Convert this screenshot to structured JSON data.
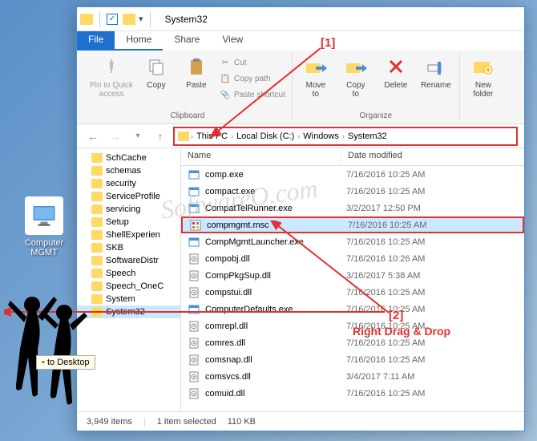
{
  "desktop": {
    "icon_label": "Computer\nMGMT"
  },
  "window": {
    "title": "System32",
    "tabs": {
      "file": "File",
      "home": "Home",
      "share": "Share",
      "view": "View"
    },
    "ribbon": {
      "pin": "Pin to Quick\naccess",
      "copy": "Copy",
      "paste": "Paste",
      "cut": "Cut",
      "copy_path": "Copy path",
      "paste_shortcut": "Paste shortcut",
      "clipboard_group": "Clipboard",
      "move_to": "Move\nto",
      "copy_to": "Copy\nto",
      "delete": "Delete",
      "rename": "Rename",
      "organize_group": "Organize",
      "new_folder": "New\nfolder"
    },
    "breadcrumb": [
      "This PC",
      "Local Disk (C:)",
      "Windows",
      "System32"
    ],
    "tree": [
      "SchCache",
      "schemas",
      "security",
      "ServiceProfile",
      "servicing",
      "Setup",
      "ShellExperien",
      "SKB",
      "SoftwareDistr",
      "Speech",
      "Speech_OneC",
      "System",
      "System32"
    ],
    "columns": {
      "name": "Name",
      "date": "Date modified"
    },
    "files": [
      {
        "name": "comp.exe",
        "date": "7/16/2016 10:25 AM",
        "type": "exe"
      },
      {
        "name": "compact.exe",
        "date": "7/16/2016 10:25 AM",
        "type": "exe"
      },
      {
        "name": "CompatTelRunner.exe",
        "date": "3/2/2017 12:50 PM",
        "type": "exe"
      },
      {
        "name": "compmgmt.msc",
        "date": "7/16/2016 10:25 AM",
        "type": "msc",
        "selected": true
      },
      {
        "name": "CompMgmtLauncher.exe",
        "date": "7/16/2016 10:25 AM",
        "type": "exe"
      },
      {
        "name": "compobj.dll",
        "date": "7/16/2016 10:26 AM",
        "type": "dll"
      },
      {
        "name": "CompPkgSup.dll",
        "date": "3/16/2017 5:38 AM",
        "type": "dll"
      },
      {
        "name": "compstui.dll",
        "date": "7/16/2016 10:25 AM",
        "type": "dll"
      },
      {
        "name": "ComputerDefaults.exe",
        "date": "7/16/2016 10:25 AM",
        "type": "exe"
      },
      {
        "name": "comrepl.dll",
        "date": "7/16/2016 10:25 AM",
        "type": "dll"
      },
      {
        "name": "comres.dll",
        "date": "7/16/2016 10:25 AM",
        "type": "dll"
      },
      {
        "name": "comsnap.dll",
        "date": "7/16/2016 10:25 AM",
        "type": "dll"
      },
      {
        "name": "comsvcs.dll",
        "date": "3/4/2017 7:11 AM",
        "type": "dll"
      },
      {
        "name": "comuid.dll",
        "date": "7/16/2016 10:25 AM",
        "type": "dll"
      }
    ],
    "status": {
      "items": "3,949 items",
      "selected": "1 item selected",
      "size": "110 KB"
    }
  },
  "annotations": {
    "marker1": "[1]",
    "marker2": "[2]",
    "right_drag": "Right Drag & Drop",
    "tooltip": "to Desktop"
  },
  "watermark": "SoftwareO.com"
}
